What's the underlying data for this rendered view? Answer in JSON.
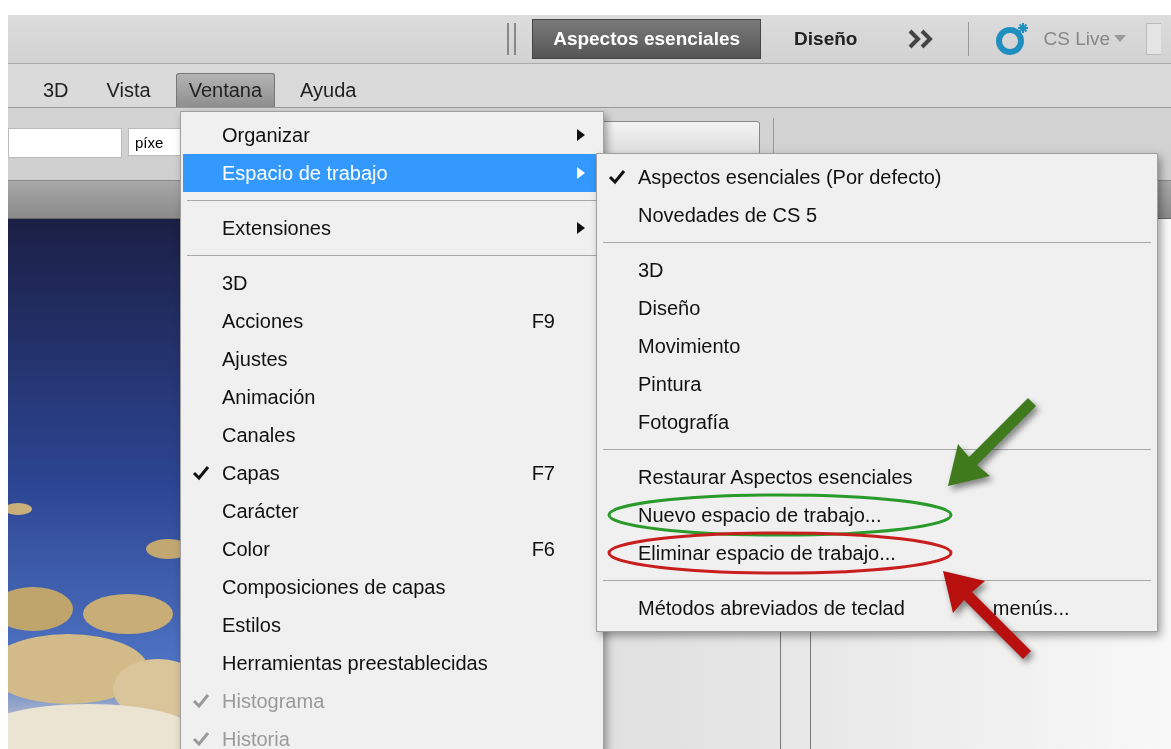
{
  "workspace_bar": {
    "switcher": [
      {
        "label": "Aspectos esenciales",
        "selected": true
      },
      {
        "label": "Diseño",
        "selected": false
      }
    ],
    "cs_live": "CS Live"
  },
  "menu_bar": [
    {
      "label": "3D",
      "selected": false
    },
    {
      "label": "Vista",
      "selected": false
    },
    {
      "label": "Ventana",
      "selected": true
    },
    {
      "label": "Ayuda",
      "selected": false
    }
  ],
  "options_bar": {
    "unit": "píxe"
  },
  "window_menu": [
    {
      "kind": "item",
      "label": "Organizar",
      "submenu": true,
      "checked": false,
      "disabled": false,
      "selected": false
    },
    {
      "kind": "item",
      "label": "Espacio de trabajo",
      "submenu": true,
      "checked": false,
      "disabled": false,
      "selected": true
    },
    {
      "kind": "separator"
    },
    {
      "kind": "item",
      "label": "Extensiones",
      "submenu": true,
      "checked": false,
      "disabled": false,
      "selected": false
    },
    {
      "kind": "separator"
    },
    {
      "kind": "item",
      "label": "3D",
      "checked": false,
      "disabled": false,
      "selected": false
    },
    {
      "kind": "item",
      "label": "Acciones",
      "shortcut": "F9",
      "checked": false,
      "disabled": false,
      "selected": false
    },
    {
      "kind": "item",
      "label": "Ajustes",
      "checked": false,
      "disabled": false,
      "selected": false
    },
    {
      "kind": "item",
      "label": "Animación",
      "checked": false,
      "disabled": false,
      "selected": false
    },
    {
      "kind": "item",
      "label": "Canales",
      "checked": false,
      "disabled": false,
      "selected": false
    },
    {
      "kind": "item",
      "label": "Capas",
      "shortcut": "F7",
      "checked": true,
      "disabled": false,
      "selected": false
    },
    {
      "kind": "item",
      "label": "Carácter",
      "checked": false,
      "disabled": false,
      "selected": false
    },
    {
      "kind": "item",
      "label": "Color",
      "shortcut": "F6",
      "checked": false,
      "disabled": false,
      "selected": false
    },
    {
      "kind": "item",
      "label": "Composiciones de capas",
      "checked": false,
      "disabled": false,
      "selected": false
    },
    {
      "kind": "item",
      "label": "Estilos",
      "checked": false,
      "disabled": false,
      "selected": false
    },
    {
      "kind": "item",
      "label": "Herramientas preestablecidas",
      "checked": false,
      "disabled": false,
      "selected": false
    },
    {
      "kind": "item",
      "label": "Histograma",
      "checked": true,
      "disabled": true,
      "selected": false
    },
    {
      "kind": "item",
      "label": "Historia",
      "checked": true,
      "disabled": true,
      "selected": false
    }
  ],
  "workspace_menu": [
    {
      "kind": "item",
      "label": "Aspectos esenciales (Por defecto)",
      "checked": true,
      "selected": false
    },
    {
      "kind": "item",
      "label": "Novedades de CS 5",
      "checked": false,
      "selected": false
    },
    {
      "kind": "separator"
    },
    {
      "kind": "item",
      "label": "3D",
      "checked": false,
      "selected": false
    },
    {
      "kind": "item",
      "label": "Diseño",
      "checked": false,
      "selected": false
    },
    {
      "kind": "item",
      "label": "Movimiento",
      "checked": false,
      "selected": false
    },
    {
      "kind": "item",
      "label": "Pintura",
      "checked": false,
      "selected": false
    },
    {
      "kind": "item",
      "label": "Fotografía",
      "checked": false,
      "selected": false
    },
    {
      "kind": "separator"
    },
    {
      "kind": "item",
      "label": "Restaurar Aspectos esenciales",
      "checked": false,
      "selected": false
    },
    {
      "kind": "item",
      "label": "Nuevo espacio de trabajo...",
      "checked": false,
      "selected": false,
      "color": "#2a9a2a"
    },
    {
      "kind": "item",
      "label": "Eliminar espacio de trabajo...",
      "checked": false,
      "selected": false,
      "color": "#c81e1e"
    },
    {
      "kind": "separator"
    },
    {
      "kind": "item",
      "label": "Métodos abreviados de teclad",
      "label_after": "menús...",
      "checked": false,
      "selected": false
    }
  ],
  "annotations": [
    {
      "kind": "arrow",
      "color": "#3f7a1c"
    },
    {
      "kind": "arrow",
      "color": "#b80f0f"
    }
  ]
}
